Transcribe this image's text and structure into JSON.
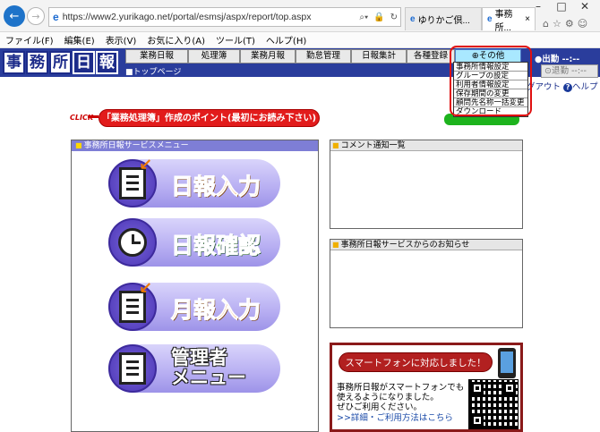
{
  "browser": {
    "url": "https://www2.yurikago.net/portal/esmsj/aspx/report/top.aspx",
    "tabs": [
      "ゆりかご倶...",
      "事務所..."
    ],
    "menu": [
      "ファイル(F)",
      "編集(E)",
      "表示(V)",
      "お気に入り(A)",
      "ツール(T)",
      "ヘルプ(H)"
    ]
  },
  "site": {
    "logo": [
      "事",
      "務",
      "所",
      "日",
      "報"
    ],
    "nav": [
      "業務日報",
      "処理簿",
      "業務月報",
      "勤怠管理",
      "日報集計",
      "各種登録"
    ],
    "nav_other": "その他",
    "breadcrumb": "トップページ",
    "shukkin": "出勤 --:--",
    "taikin": "退勤 --:--",
    "logout": "グアウト",
    "help": "ヘルプ"
  },
  "dropdown": [
    "事務所情報設定",
    "グループの設定",
    "利用者情報設定",
    "保存期間の変更",
    "顧問先名称一括変更",
    "ダウンロード"
  ],
  "banner": {
    "click": "CLICK",
    "text": "「業務処理簿」作成のポイント(最初にお読み下さい)"
  },
  "panels": {
    "menu_title": "事務所日報サービスメニュー",
    "comment_title": "コメント通知一覧",
    "notice_title": "事務所日報サービスからのお知らせ"
  },
  "menu_buttons": [
    "日報入力",
    "日報確認",
    "月報入力",
    "管理者",
    "メニュー"
  ],
  "smartphone": {
    "banner": "スマートフォンに対応しました！",
    "line1": "事務所日報がスマートフォンでも",
    "line2": "使えるようになりました。",
    "line3": "ぜひご利用ください。",
    "link": ">>詳細・ご利用方法はこちら"
  },
  "colors": {
    "header": "#2a3d9c",
    "accent_red": "#e21c1c",
    "menu_purple": "#7e7ed6"
  }
}
